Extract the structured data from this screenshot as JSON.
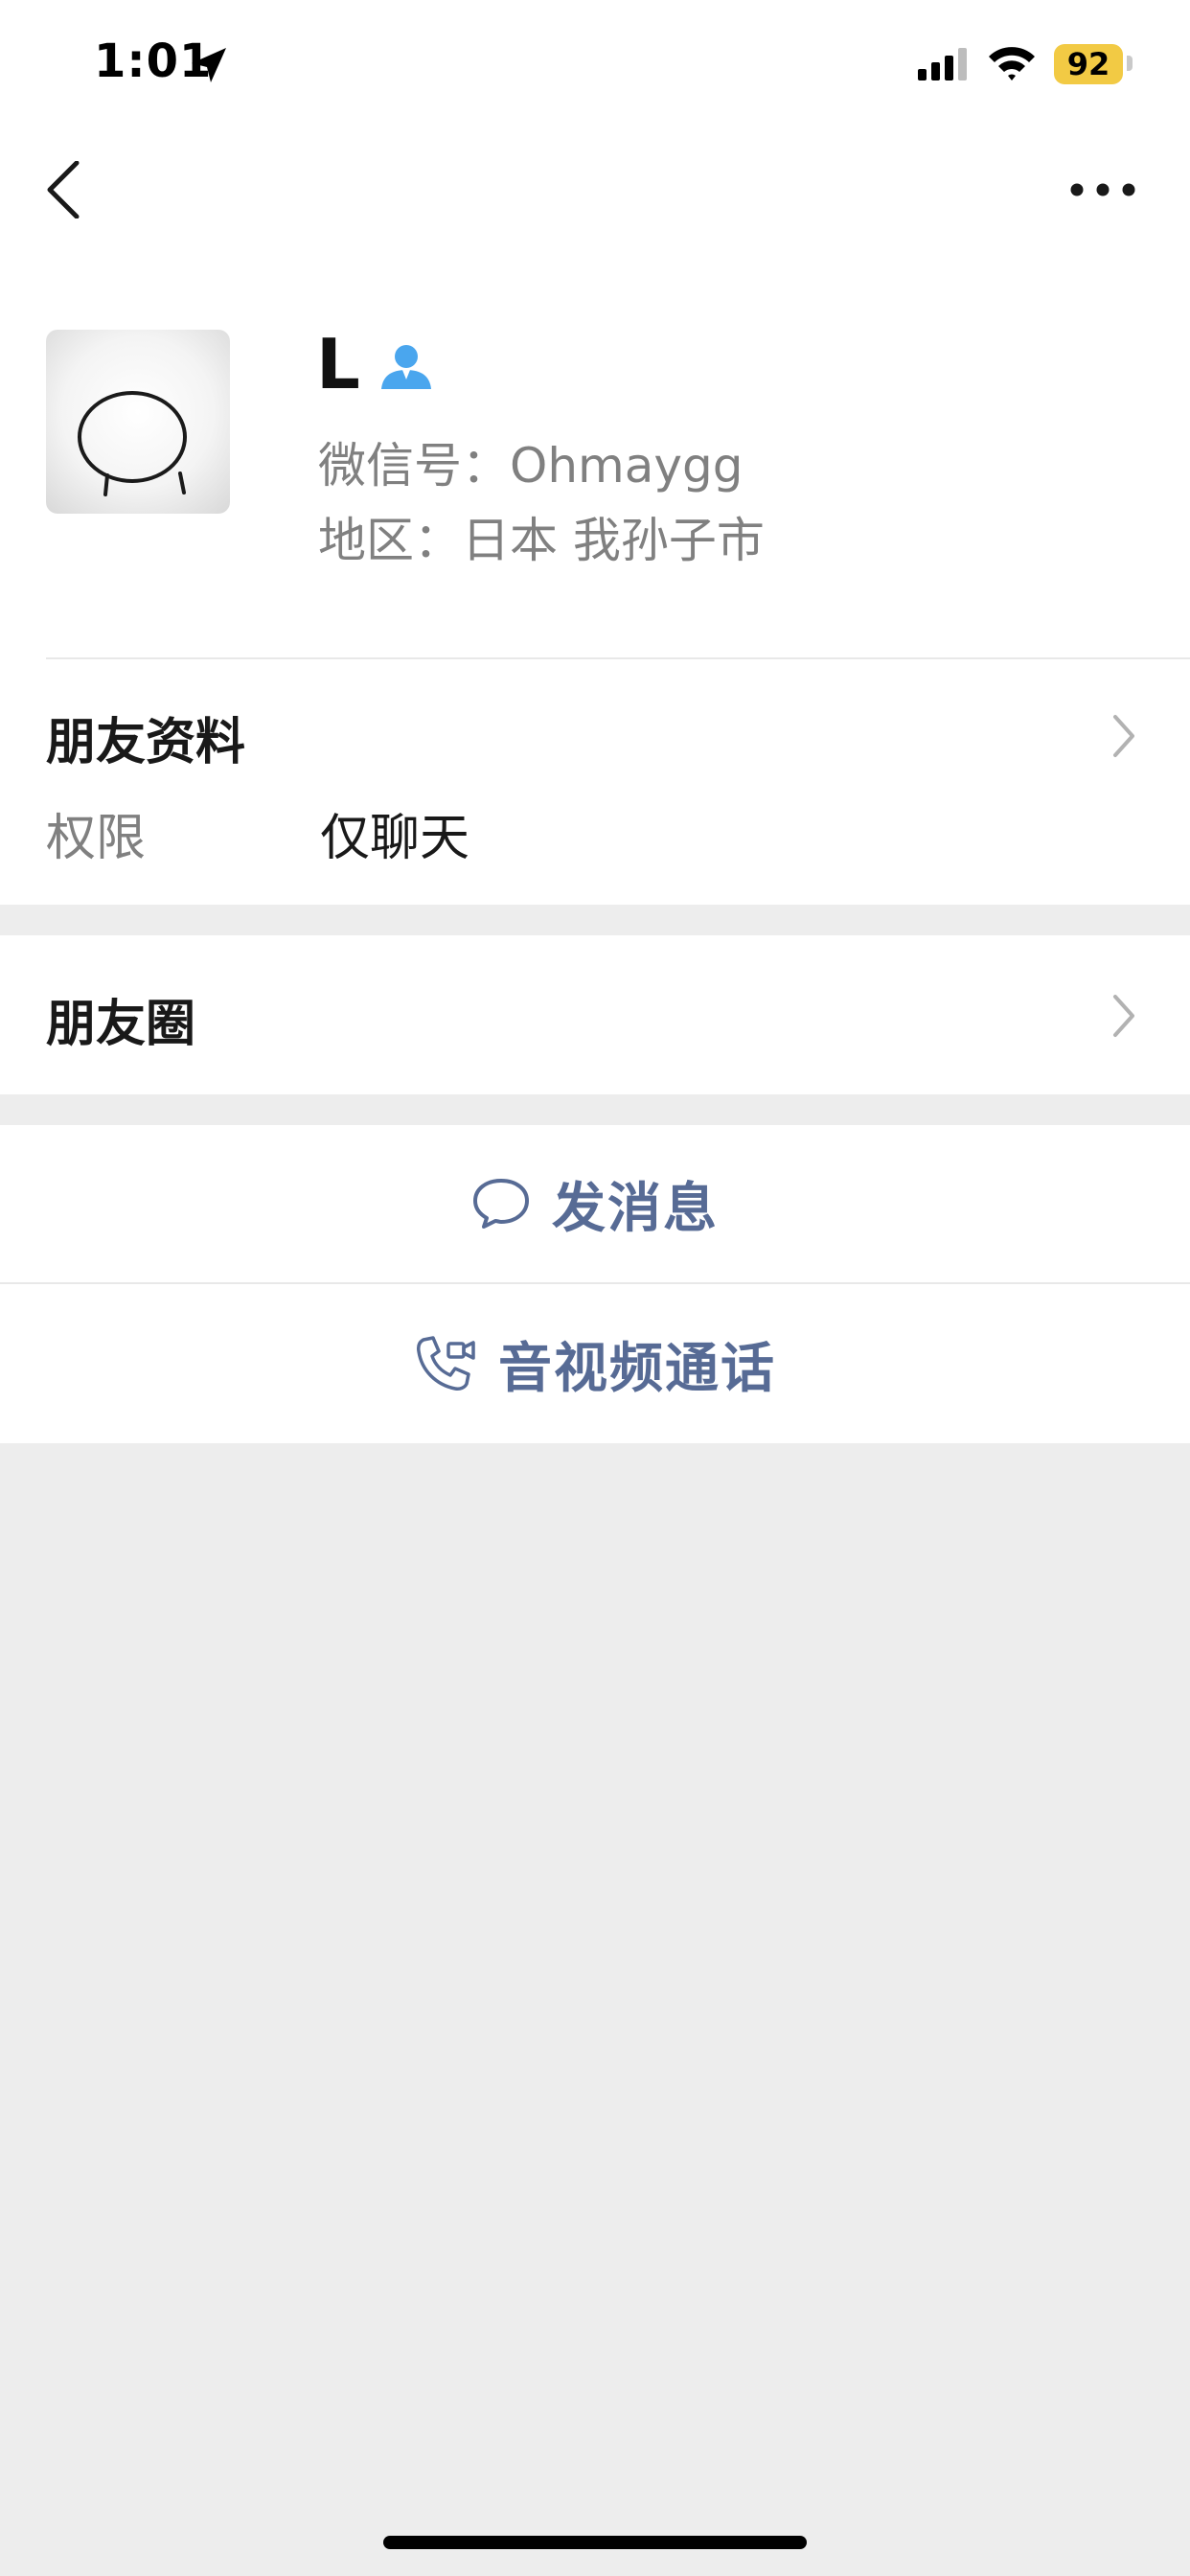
{
  "status_bar": {
    "time": "1:01",
    "battery": "92"
  },
  "nav": {
    "back_icon": "chevron-left-icon",
    "more_icon": "more-dots-icon"
  },
  "profile": {
    "name": "L",
    "wechat_id": "微信号：Ohmaygg",
    "region": "地区：日本 我孙子市"
  },
  "friend_info": {
    "title": "朋友资料",
    "permission_label": "权限",
    "permission_value": "仅聊天"
  },
  "moments": {
    "title": "朋友圈"
  },
  "actions": {
    "message_label": "发消息",
    "call_label": "音视频通话"
  },
  "colors": {
    "accent": "#576b95",
    "battery": "#f2ca44",
    "background": "#ededed"
  }
}
